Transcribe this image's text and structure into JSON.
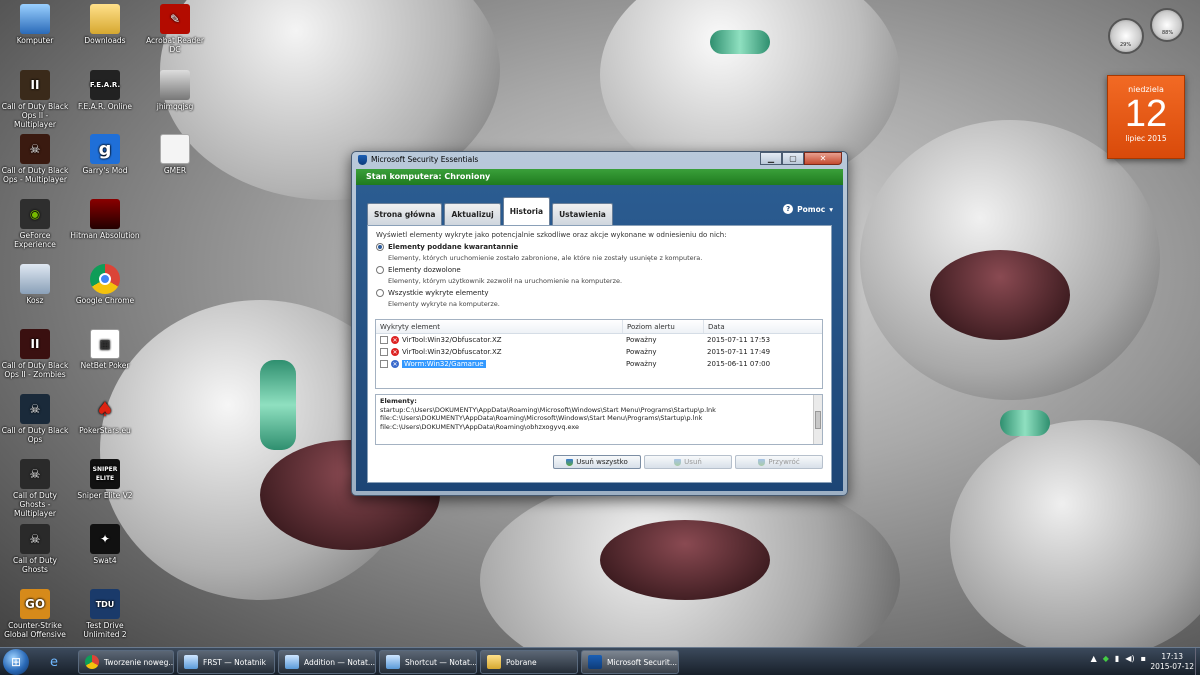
{
  "desktop": {
    "icons": [
      {
        "label": "Komputer"
      },
      {
        "label": "Downloads"
      },
      {
        "label": "Acrobat Reader DC"
      },
      {
        "label": "Call of Duty Black Ops II - Multiplayer"
      },
      {
        "label": "F.E.A.R. Online"
      },
      {
        "label": "jhimqqjsg"
      },
      {
        "label": "Call of Duty Black Ops - Multiplayer"
      },
      {
        "label": "Garry's Mod"
      },
      {
        "label": "GMER"
      },
      {
        "label": "GeForce Experience"
      },
      {
        "label": "Hitman Absolution"
      },
      {
        "label": "Kosz"
      },
      {
        "label": "Google Chrome"
      },
      {
        "label": "Call of Duty Black Ops II - Zombies"
      },
      {
        "label": "NetBet Poker"
      },
      {
        "label": "Call of Duty Black Ops"
      },
      {
        "label": "PokerStars.eu"
      },
      {
        "label": "Call of Duty Ghosts - Multiplayer"
      },
      {
        "label": "Sniper Elite V2"
      },
      {
        "label": "Call of Duty Ghosts"
      },
      {
        "label": "Swat4"
      },
      {
        "label": "Counter-Strike Global Offensive"
      },
      {
        "label": "Test Drive Unlimited 2"
      }
    ],
    "icon_glyphs": {
      "fear": "F.E.A.R.",
      "garrys": "g",
      "sniper": "SNIPER ELITE",
      "csgo": "GO",
      "tdu": "TDU"
    }
  },
  "calendar": {
    "weekday": "niedziela",
    "day": "12",
    "month_year": "lipiec 2015"
  },
  "meters": {
    "left": "29%",
    "right": "88%"
  },
  "window": {
    "title": "Microsoft Security Essentials",
    "status": "Stan komputera: Chroniony",
    "tabs": [
      {
        "label": "Strona główna"
      },
      {
        "label": "Aktualizuj"
      },
      {
        "label": "Historia"
      },
      {
        "label": "Ustawienia"
      }
    ],
    "help_label": "Pomoc",
    "intro": "Wyświetl elementy wykryte jako potencjalnie szkodliwe oraz akcje wykonane w odniesieniu do nich:",
    "options": [
      {
        "label": "Elementy poddane kwarantannie",
        "desc": "Elementy, których uruchomienie zostało zabronione, ale które nie zostały usunięte z komputera."
      },
      {
        "label": "Elementy dozwolone",
        "desc": "Elementy, którym użytkownik zezwolił na uruchomienie na komputerze."
      },
      {
        "label": "Wszystkie wykryte elementy",
        "desc": "Elementy wykryte na komputerze."
      }
    ],
    "table": {
      "headers": [
        "Wykryty element",
        "Poziom alertu",
        "Data"
      ],
      "rows": [
        {
          "name": "VirTool:Win32/Obfuscator.XZ",
          "level": "Poważny",
          "date": "2015-07-11 17:53"
        },
        {
          "name": "VirTool:Win32/Obfuscator.XZ",
          "level": "Poważny",
          "date": "2015-07-11 17:49"
        },
        {
          "name": "Worm:Win32/Gamarue",
          "level": "Poważny",
          "date": "2015-06-11 07:00"
        }
      ]
    },
    "details": {
      "heading": "Elementy:",
      "lines": [
        "startup:C:\\Users\\DOKUMENTY\\AppData\\Roaming\\Microsoft\\Windows\\Start Menu\\Programs\\Startup\\p.lnk",
        "file:C:\\Users\\DOKUMENTY\\AppData\\Roaming\\Microsoft\\Windows\\Start Menu\\Programs\\Startup\\p.lnk",
        "file:C:\\Users\\DOKUMENTY\\AppData\\Roaming\\obhzxogyvq.exe"
      ]
    },
    "buttons": {
      "remove_all": "Usuń wszystko",
      "remove": "Usuń",
      "restore": "Przywróć"
    }
  },
  "taskbar": {
    "tasks": [
      {
        "label": "Tworzenie noweg..."
      },
      {
        "label": "FRST — Notatnik"
      },
      {
        "label": "Addition — Notat..."
      },
      {
        "label": "Shortcut — Notat..."
      },
      {
        "label": "Pobrane"
      },
      {
        "label": "Microsoft Securit..."
      }
    ],
    "clock_time": "17:13",
    "clock_date": "2015-07-12"
  }
}
